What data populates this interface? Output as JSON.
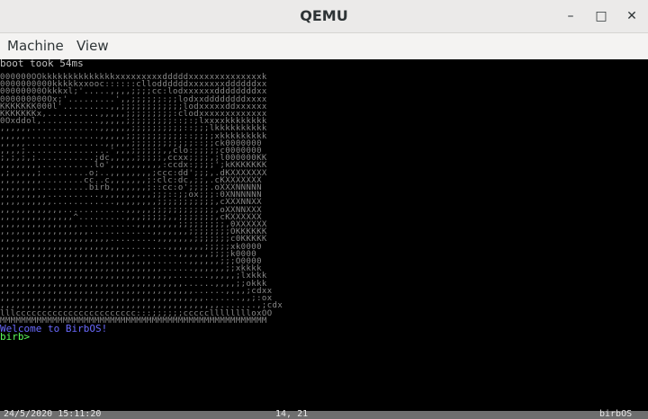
{
  "window": {
    "title": "QEMU"
  },
  "menu": {
    "items": [
      "Machine",
      "View"
    ]
  },
  "console": {
    "boot_line": "boot took 54ms",
    "welcome_line": "Welcome to BirbOS!",
    "prompt": "birb>"
  },
  "status": {
    "datetime": "24/5/2020 15:11:20",
    "cursor": "14, 21",
    "os_name": "birbOS"
  },
  "colors": {
    "welcome": "#6a6aff",
    "prompt": "#5cff5c",
    "status_bg": "#6e6e6e"
  }
}
